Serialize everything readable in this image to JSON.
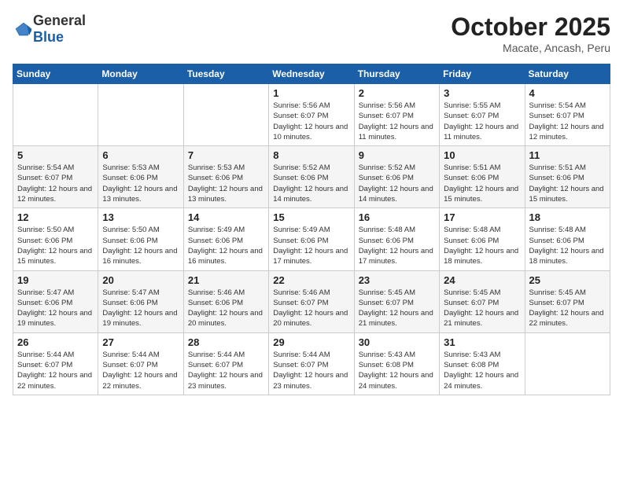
{
  "header": {
    "logo_general": "General",
    "logo_blue": "Blue",
    "month": "October 2025",
    "location": "Macate, Ancash, Peru"
  },
  "weekdays": [
    "Sunday",
    "Monday",
    "Tuesday",
    "Wednesday",
    "Thursday",
    "Friday",
    "Saturday"
  ],
  "weeks": [
    [
      {
        "day": "",
        "info": ""
      },
      {
        "day": "",
        "info": ""
      },
      {
        "day": "",
        "info": ""
      },
      {
        "day": "1",
        "info": "Sunrise: 5:56 AM\nSunset: 6:07 PM\nDaylight: 12 hours\nand 10 minutes."
      },
      {
        "day": "2",
        "info": "Sunrise: 5:56 AM\nSunset: 6:07 PM\nDaylight: 12 hours\nand 11 minutes."
      },
      {
        "day": "3",
        "info": "Sunrise: 5:55 AM\nSunset: 6:07 PM\nDaylight: 12 hours\nand 11 minutes."
      },
      {
        "day": "4",
        "info": "Sunrise: 5:54 AM\nSunset: 6:07 PM\nDaylight: 12 hours\nand 12 minutes."
      }
    ],
    [
      {
        "day": "5",
        "info": "Sunrise: 5:54 AM\nSunset: 6:07 PM\nDaylight: 12 hours\nand 12 minutes."
      },
      {
        "day": "6",
        "info": "Sunrise: 5:53 AM\nSunset: 6:06 PM\nDaylight: 12 hours\nand 13 minutes."
      },
      {
        "day": "7",
        "info": "Sunrise: 5:53 AM\nSunset: 6:06 PM\nDaylight: 12 hours\nand 13 minutes."
      },
      {
        "day": "8",
        "info": "Sunrise: 5:52 AM\nSunset: 6:06 PM\nDaylight: 12 hours\nand 14 minutes."
      },
      {
        "day": "9",
        "info": "Sunrise: 5:52 AM\nSunset: 6:06 PM\nDaylight: 12 hours\nand 14 minutes."
      },
      {
        "day": "10",
        "info": "Sunrise: 5:51 AM\nSunset: 6:06 PM\nDaylight: 12 hours\nand 15 minutes."
      },
      {
        "day": "11",
        "info": "Sunrise: 5:51 AM\nSunset: 6:06 PM\nDaylight: 12 hours\nand 15 minutes."
      }
    ],
    [
      {
        "day": "12",
        "info": "Sunrise: 5:50 AM\nSunset: 6:06 PM\nDaylight: 12 hours\nand 15 minutes."
      },
      {
        "day": "13",
        "info": "Sunrise: 5:50 AM\nSunset: 6:06 PM\nDaylight: 12 hours\nand 16 minutes."
      },
      {
        "day": "14",
        "info": "Sunrise: 5:49 AM\nSunset: 6:06 PM\nDaylight: 12 hours\nand 16 minutes."
      },
      {
        "day": "15",
        "info": "Sunrise: 5:49 AM\nSunset: 6:06 PM\nDaylight: 12 hours\nand 17 minutes."
      },
      {
        "day": "16",
        "info": "Sunrise: 5:48 AM\nSunset: 6:06 PM\nDaylight: 12 hours\nand 17 minutes."
      },
      {
        "day": "17",
        "info": "Sunrise: 5:48 AM\nSunset: 6:06 PM\nDaylight: 12 hours\nand 18 minutes."
      },
      {
        "day": "18",
        "info": "Sunrise: 5:48 AM\nSunset: 6:06 PM\nDaylight: 12 hours\nand 18 minutes."
      }
    ],
    [
      {
        "day": "19",
        "info": "Sunrise: 5:47 AM\nSunset: 6:06 PM\nDaylight: 12 hours\nand 19 minutes."
      },
      {
        "day": "20",
        "info": "Sunrise: 5:47 AM\nSunset: 6:06 PM\nDaylight: 12 hours\nand 19 minutes."
      },
      {
        "day": "21",
        "info": "Sunrise: 5:46 AM\nSunset: 6:06 PM\nDaylight: 12 hours\nand 20 minutes."
      },
      {
        "day": "22",
        "info": "Sunrise: 5:46 AM\nSunset: 6:07 PM\nDaylight: 12 hours\nand 20 minutes."
      },
      {
        "day": "23",
        "info": "Sunrise: 5:45 AM\nSunset: 6:07 PM\nDaylight: 12 hours\nand 21 minutes."
      },
      {
        "day": "24",
        "info": "Sunrise: 5:45 AM\nSunset: 6:07 PM\nDaylight: 12 hours\nand 21 minutes."
      },
      {
        "day": "25",
        "info": "Sunrise: 5:45 AM\nSunset: 6:07 PM\nDaylight: 12 hours\nand 22 minutes."
      }
    ],
    [
      {
        "day": "26",
        "info": "Sunrise: 5:44 AM\nSunset: 6:07 PM\nDaylight: 12 hours\nand 22 minutes."
      },
      {
        "day": "27",
        "info": "Sunrise: 5:44 AM\nSunset: 6:07 PM\nDaylight: 12 hours\nand 22 minutes."
      },
      {
        "day": "28",
        "info": "Sunrise: 5:44 AM\nSunset: 6:07 PM\nDaylight: 12 hours\nand 23 minutes."
      },
      {
        "day": "29",
        "info": "Sunrise: 5:44 AM\nSunset: 6:07 PM\nDaylight: 12 hours\nand 23 minutes."
      },
      {
        "day": "30",
        "info": "Sunrise: 5:43 AM\nSunset: 6:08 PM\nDaylight: 12 hours\nand 24 minutes."
      },
      {
        "day": "31",
        "info": "Sunrise: 5:43 AM\nSunset: 6:08 PM\nDaylight: 12 hours\nand 24 minutes."
      },
      {
        "day": "",
        "info": ""
      }
    ]
  ]
}
